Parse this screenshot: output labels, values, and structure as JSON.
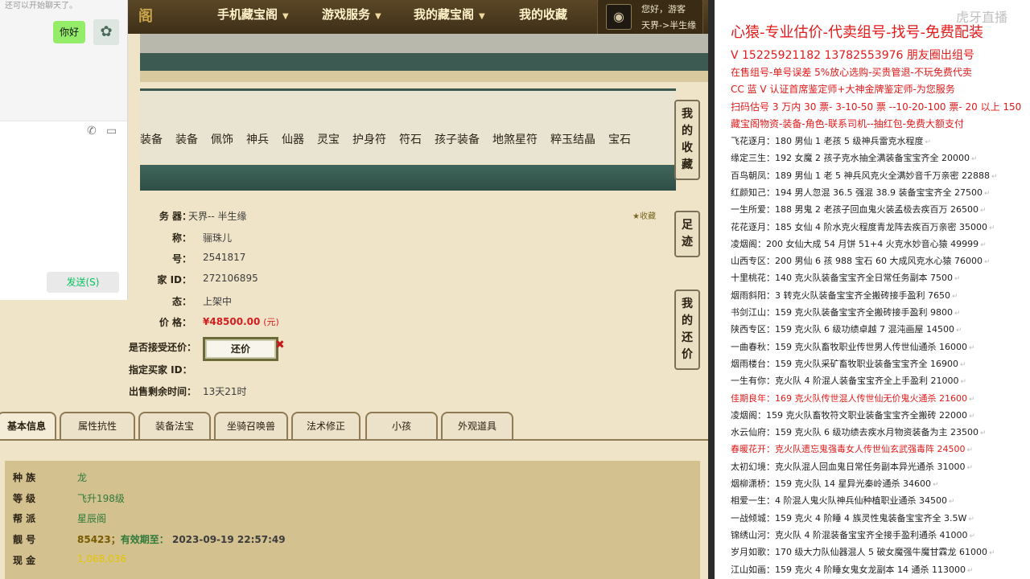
{
  "game": {
    "brand": "阁",
    "nav": [
      {
        "label": "手机藏宝阁",
        "dropdown": true
      },
      {
        "label": "游戏服务",
        "dropdown": true
      },
      {
        "label": "我的藏宝阁",
        "dropdown": true
      },
      {
        "label": "我的收藏",
        "dropdown": false
      }
    ],
    "user": {
      "greeting": "您好，游客",
      "server": "天界->半生缘"
    },
    "categories": [
      "装备",
      "装备",
      "佩饰",
      "神兵",
      "仙器",
      "灵宝",
      "护身符",
      "符石",
      "孩子装备",
      "地煞星符",
      "粹玉结晶",
      "宝石"
    ],
    "side_buttons": [
      "我的收藏",
      "足迹",
      "我的还价"
    ],
    "favorite_label": "收藏",
    "info": [
      {
        "key": "务  器：",
        "value": "天界-- 半生缘"
      },
      {
        "key": "称：",
        "value": "骊珠儿"
      },
      {
        "key": "号：",
        "value": "2541817"
      },
      {
        "key": "家   ID：",
        "value": "272106895"
      },
      {
        "key": "态：",
        "value": "上架中"
      },
      {
        "key": "价      格：",
        "value": "¥48500.00",
        "unit": "(元)"
      },
      {
        "key": "是否接受还价：",
        "button": "还价",
        "mark": "✖"
      },
      {
        "key": "指定买家 ID：",
        "value": ""
      },
      {
        "key": "出售剩余时间：",
        "value": "13天21时"
      }
    ],
    "tabs": [
      "基本信息",
      "属性抗性",
      "装备法宝",
      "坐骑召唤兽",
      "法术修正",
      "小孩",
      "外观道具"
    ],
    "basic": [
      {
        "key": "种      族",
        "value": "龙"
      },
      {
        "key": "等      级",
        "value": "飞升198级"
      },
      {
        "key": "帮      派",
        "value": "星辰阁"
      },
      {
        "key": "靓      号",
        "value": "85423",
        "extra": "有效期至：",
        "expire": "2023-09-19 22:57:49"
      },
      {
        "key": "现      金",
        "value": "1,068,036"
      }
    ]
  },
  "chat": {
    "top_text": "还可以开始聊天了。",
    "message": "你好",
    "send_label": "发送(S)"
  },
  "panel": {
    "watermark": "虎牙直播",
    "headline": "心猿-专业估价-代卖组号-找号-免费配装",
    "promo": [
      "V 15225921182   13782553976 朋友圈出组号",
      "在售组号-单号误差 5%放心选购-买贵管退-不玩免费代卖",
      "CC 蓝 V 认证首席鉴定师+大神金牌鉴定师-为您服务",
      "扫码估号 3 万内 30 票- 3-10-50 票  --10-20-100 票- 20 以上 150",
      "藏宝阁物资-装备-角色-联系司机--抽红包-免费大额支付"
    ],
    "listings": [
      {
        "text": "飞花逐月：180 男仙 1 老孩 5 级神兵雷克水程度",
        "red": false
      },
      {
        "text": "缘定三生：192 女魔 2 孩子克水抽全满装备宝宝齐全 20000",
        "red": false
      },
      {
        "text": "百鸟朝凤：189 男仙 1 老 5 神兵风克火全满妙音千万亲密 22888",
        "red": false
      },
      {
        "text": "红颜知己：194 男人忽混 36.5 强混 38.9 装备宝宝齐全 27500",
        "red": false
      },
      {
        "text": "一生所爱：188 男鬼 2 老孩子回血鬼火装孟极去疾百万 26500",
        "red": false
      },
      {
        "text": "花花逐月：185 女仙 4 阶水克火程度青龙阵去疾百万亲密 35000",
        "red": false
      },
      {
        "text": "凌烟阁：200 女仙大成 54 月饼 51+4 火克水妙音心猿 49999",
        "red": false
      },
      {
        "text": "山西专区：200 男仙 6 孩 988 宝石 60 大成风克水心猿 76000",
        "red": false
      },
      {
        "text": "十里桃花：140 克火队装备宝宝齐全日常任务副本 7500",
        "red": false
      },
      {
        "text": "烟雨斜阳：3 转克火队装备宝宝齐全搬砖接手盈利 7650",
        "red": false
      },
      {
        "text": "书剑江山：159 克火队装备宝宝齐全搬砖接手盈利 9800",
        "red": false
      },
      {
        "text": "陕西专区：159 克火队 6 级功绩卓越 7 混沌画屋 14500",
        "red": false
      },
      {
        "text": "一曲春秋：159 克火队畜牧职业传世男人传世仙通杀 16000",
        "red": false
      },
      {
        "text": "烟雨楼台：159 克火队采矿畜牧职业装备宝宝齐全 16900",
        "red": false
      },
      {
        "text": "一生有你：克火队 4 阶混人装备宝宝齐全上手盈利 21000",
        "red": false
      },
      {
        "text": "佳期良年：169 克火队传世混人传世仙无价鬼火通杀 21600",
        "red": true
      },
      {
        "text": "凌烟阁：159 克火队畜牧符文职业装备宝宝齐全搬砖 22000",
        "red": false
      },
      {
        "text": "水云仙府：159 克火队 6 级功绩去疾水月物资装备为主 23500",
        "red": false
      },
      {
        "text": "春暖花开：克火队遗忘鬼强毒女人传世仙玄武强毒阵 24500",
        "red": true
      },
      {
        "text": "太初幻境：克火队混人回血鬼日常任务副本异光通杀 31000",
        "red": false
      },
      {
        "text": "烟柳潇桥：159 克火队 14 星异光秦岭通杀 34600",
        "red": false
      },
      {
        "text": "相爱一生：4 阶混人鬼火队神兵仙种植职业通杀 34500",
        "red": false
      },
      {
        "text": "一战倾城：159 克火 4 阶睡 4 族灵性鬼装备宝宝齐全 3.5W",
        "red": false
      },
      {
        "text": "锦绣山河：克火队 4 阶混装备宝宝齐全接手盈利通杀 41000",
        "red": false
      },
      {
        "text": "岁月如歌：170 级大力队仙器混人 5 破女魔强牛魔甘霖龙 61000",
        "red": false
      },
      {
        "text": "江山如画：159 克火 4 阶睡女鬼女龙副本 14 通杀 113000",
        "red": false
      }
    ]
  }
}
